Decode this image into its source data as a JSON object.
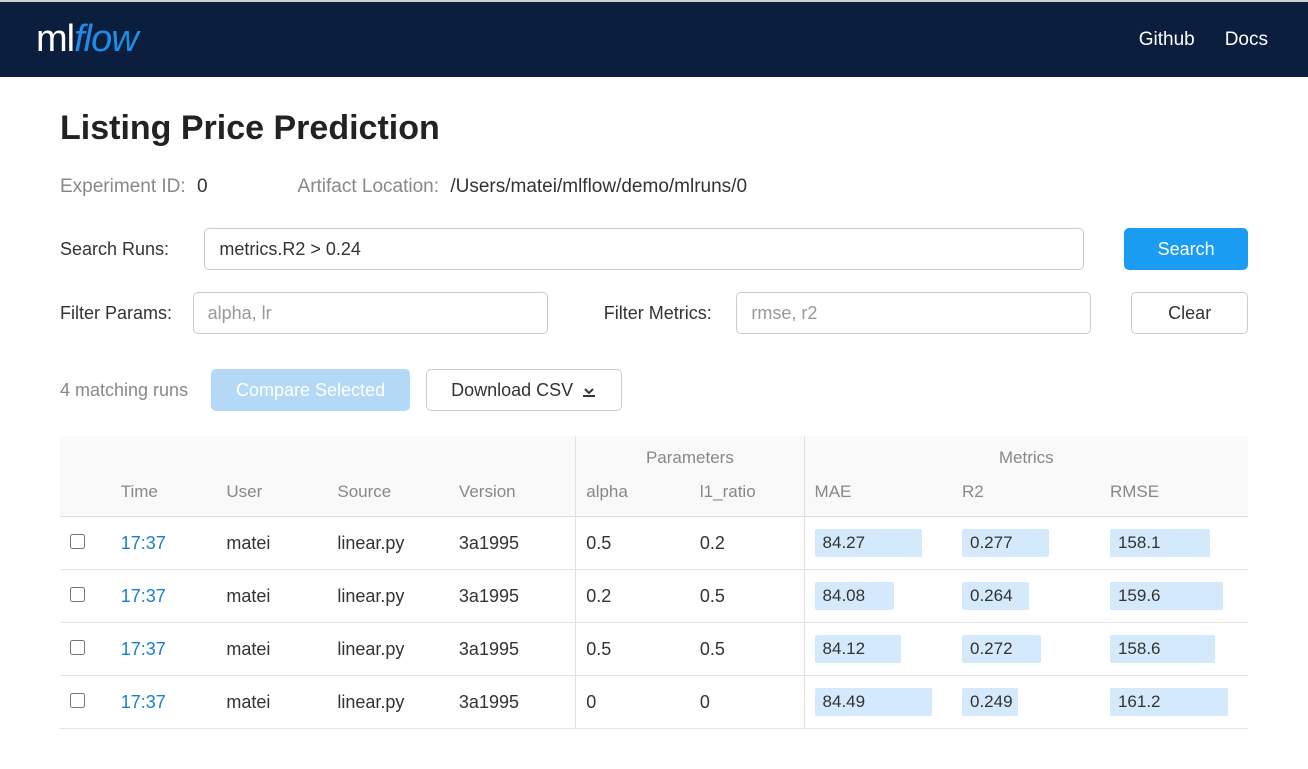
{
  "nav": {
    "github": "Github",
    "docs": "Docs"
  },
  "page": {
    "title": "Listing Price Prediction",
    "experiment_id_label": "Experiment ID:",
    "experiment_id": "0",
    "artifact_label": "Artifact Location:",
    "artifact_location": "/Users/matei/mlflow/demo/mlruns/0"
  },
  "form": {
    "search_label": "Search Runs:",
    "search_value": "metrics.R2 > 0.24",
    "search_button": "Search",
    "filter_params_label": "Filter Params:",
    "filter_params_placeholder": "alpha, lr",
    "filter_metrics_label": "Filter Metrics:",
    "filter_metrics_placeholder": "rmse, r2",
    "clear_button": "Clear"
  },
  "actions": {
    "matching_runs": "4 matching runs",
    "compare_selected": "Compare Selected",
    "download_csv": "Download CSV"
  },
  "table": {
    "group_headers": {
      "parameters": "Parameters",
      "metrics": "Metrics"
    },
    "headers": {
      "time": "Time",
      "user": "User",
      "source": "Source",
      "version": "Version",
      "alpha": "alpha",
      "l1_ratio": "l1_ratio",
      "mae": "MAE",
      "r2": "R2",
      "rmse": "RMSE"
    },
    "rows": [
      {
        "time": "17:37",
        "user": "matei",
        "source": "linear.py",
        "version": "3a1995",
        "alpha": "0.5",
        "l1_ratio": "0.2",
        "mae": "84.27",
        "r2": "0.277",
        "rmse": "158.1",
        "mae_w": 84,
        "r2_w": 68,
        "rmse_w": 78
      },
      {
        "time": "17:37",
        "user": "matei",
        "source": "linear.py",
        "version": "3a1995",
        "alpha": "0.2",
        "l1_ratio": "0.5",
        "mae": "84.08",
        "r2": "0.264",
        "rmse": "159.6",
        "mae_w": 62,
        "r2_w": 52,
        "rmse_w": 88
      },
      {
        "time": "17:37",
        "user": "matei",
        "source": "linear.py",
        "version": "3a1995",
        "alpha": "0.5",
        "l1_ratio": "0.5",
        "mae": "84.12",
        "r2": "0.272",
        "rmse": "158.6",
        "mae_w": 68,
        "r2_w": 62,
        "rmse_w": 82
      },
      {
        "time": "17:37",
        "user": "matei",
        "source": "linear.py",
        "version": "3a1995",
        "alpha": "0",
        "l1_ratio": "0",
        "mae": "84.49",
        "r2": "0.249",
        "rmse": "161.2",
        "mae_w": 92,
        "r2_w": 44,
        "rmse_w": 92
      }
    ]
  }
}
